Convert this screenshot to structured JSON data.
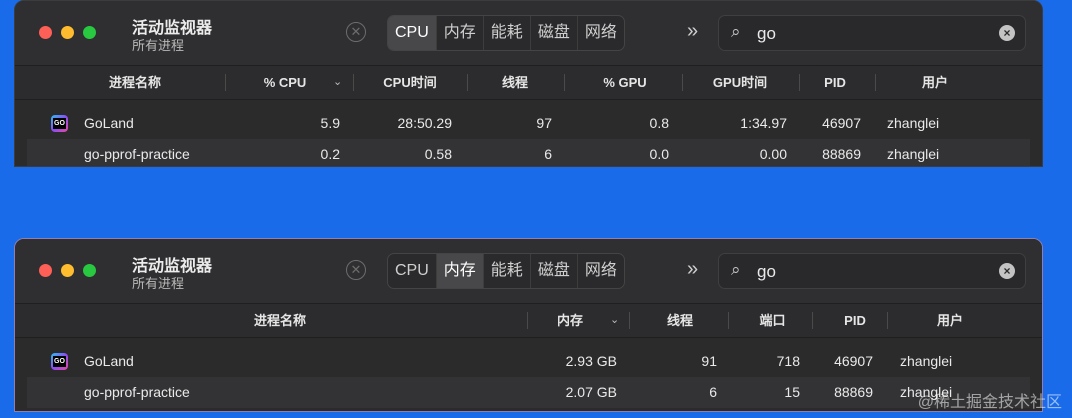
{
  "windows": [
    {
      "title": "活动监视器",
      "subtitle": "所有进程",
      "tabs": [
        "CPU",
        "内存",
        "能耗",
        "磁盘",
        "网络"
      ],
      "active_tab": "CPU",
      "search_value": "go",
      "columns": [
        "进程名称",
        "% CPU",
        "CPU时间",
        "线程",
        "% GPU",
        "GPU时间",
        "PID",
        "用户"
      ],
      "sorted_column": "% CPU",
      "rows": [
        {
          "name": "GoLand",
          "cpu": "5.9",
          "cpu_time": "28:50.29",
          "threads": "97",
          "gpu": "0.8",
          "gpu_time": "1:34.97",
          "pid": "46907",
          "user": "zhanglei"
        },
        {
          "name": "go-pprof-practice",
          "cpu": "0.2",
          "cpu_time": "0.58",
          "threads": "6",
          "gpu": "0.0",
          "gpu_time": "0.00",
          "pid": "88869",
          "user": "zhanglei"
        }
      ]
    },
    {
      "title": "活动监视器",
      "subtitle": "所有进程",
      "tabs": [
        "CPU",
        "内存",
        "能耗",
        "磁盘",
        "网络"
      ],
      "active_tab": "内存",
      "search_value": "go",
      "columns": [
        "进程名称",
        "内存",
        "线程",
        "端口",
        "PID",
        "用户"
      ],
      "sorted_column": "内存",
      "rows": [
        {
          "name": "GoLand",
          "memory": "2.93 GB",
          "threads": "91",
          "ports": "718",
          "pid": "46907",
          "user": "zhanglei"
        },
        {
          "name": "go-pprof-practice",
          "memory": "2.07 GB",
          "threads": "6",
          "ports": "15",
          "pid": "88869",
          "user": "zhanglei"
        }
      ]
    }
  ],
  "watermark": "@稀土掘金技术社区"
}
